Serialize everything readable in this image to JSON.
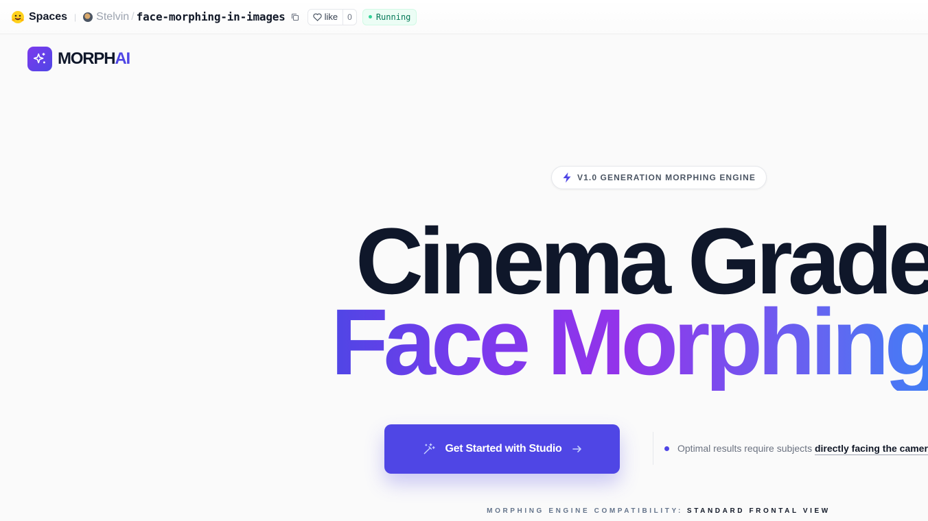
{
  "hf_bar": {
    "spaces_label": "Spaces",
    "owner": "Stelvin",
    "separator": "/",
    "repo_name": "face-morphing-in-images",
    "like_label": "like",
    "like_count": "0",
    "status": "Running",
    "icons": [
      "hugging-face-logo",
      "copy-icon",
      "heart-icon"
    ]
  },
  "app": {
    "brand_main": "MORPH",
    "brand_accent": "AI",
    "badge_text": "V1.0 GENERATION MORPHING ENGINE",
    "headline_line1": "Cinema Grade",
    "headline_line2": "Face Morphing",
    "cta_label": "Get Started with Studio",
    "tip_prefix": "Optimal results require subjects",
    "tip_emphasis": "directly facing the camera",
    "compat_label": "MORPHING ENGINE COMPATIBILITY:",
    "compat_value": "STANDARD FRONTAL VIEW"
  },
  "colors": {
    "accent": "#4f46e5",
    "dark": "#0f172a",
    "gradient": [
      "#4f46e5",
      "#7c3aed",
      "#9333ea",
      "#6366f1",
      "#3b82f6"
    ],
    "status_green": "#047857"
  }
}
